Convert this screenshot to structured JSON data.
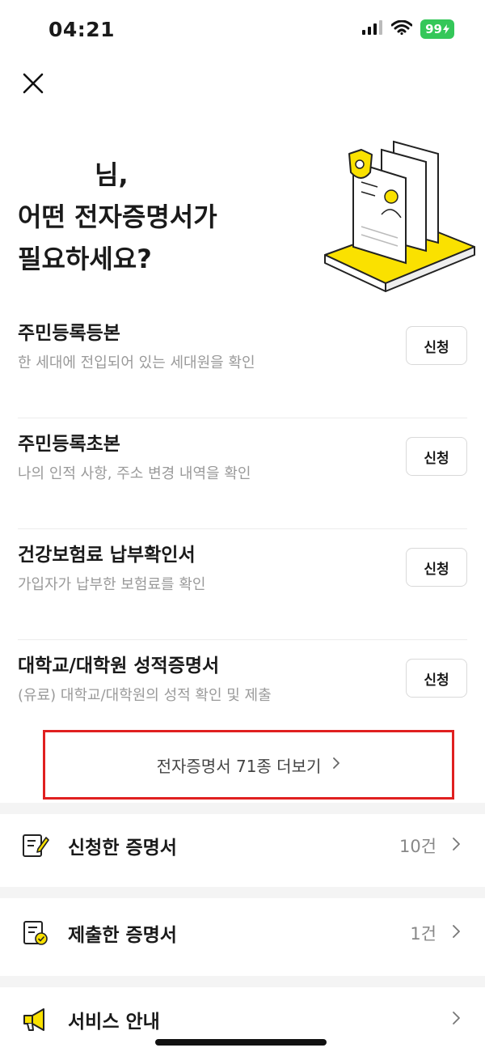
{
  "status_bar": {
    "time": "04:21",
    "battery": "99"
  },
  "header": {
    "close_icon": "close-icon"
  },
  "headline": {
    "line1": "님,",
    "line2": "어떤 전자증명서가",
    "line3": "필요하세요?"
  },
  "certificates": [
    {
      "title": "주민등록등본",
      "desc": "한 세대에 전입되어 있는 세대원을 확인",
      "button": "신청"
    },
    {
      "title": "주민등록초본",
      "desc": "나의 인적 사항, 주소 변경 내역을 확인",
      "button": "신청"
    },
    {
      "title": "건강보험료 납부확인서",
      "desc": "가입자가 납부한 보험료를 확인",
      "button": "신청"
    },
    {
      "title": "대학교/대학원 성적증명서",
      "desc": "(유료) 대학교/대학원의 성적 확인 및 제출",
      "button": "신청"
    }
  ],
  "more": {
    "label": "전자증명서 71종 더보기"
  },
  "menu": [
    {
      "label": "신청한 증명서",
      "count": "10건",
      "icon": "edit-document-icon"
    },
    {
      "label": "제출한 증명서",
      "count": "1건",
      "icon": "checked-document-icon"
    },
    {
      "label": "서비스 안내",
      "count": "",
      "icon": "megaphone-icon"
    }
  ],
  "colors": {
    "accent_yellow": "#fae100",
    "highlight_red": "#e02020",
    "battery_green": "#34c759"
  }
}
